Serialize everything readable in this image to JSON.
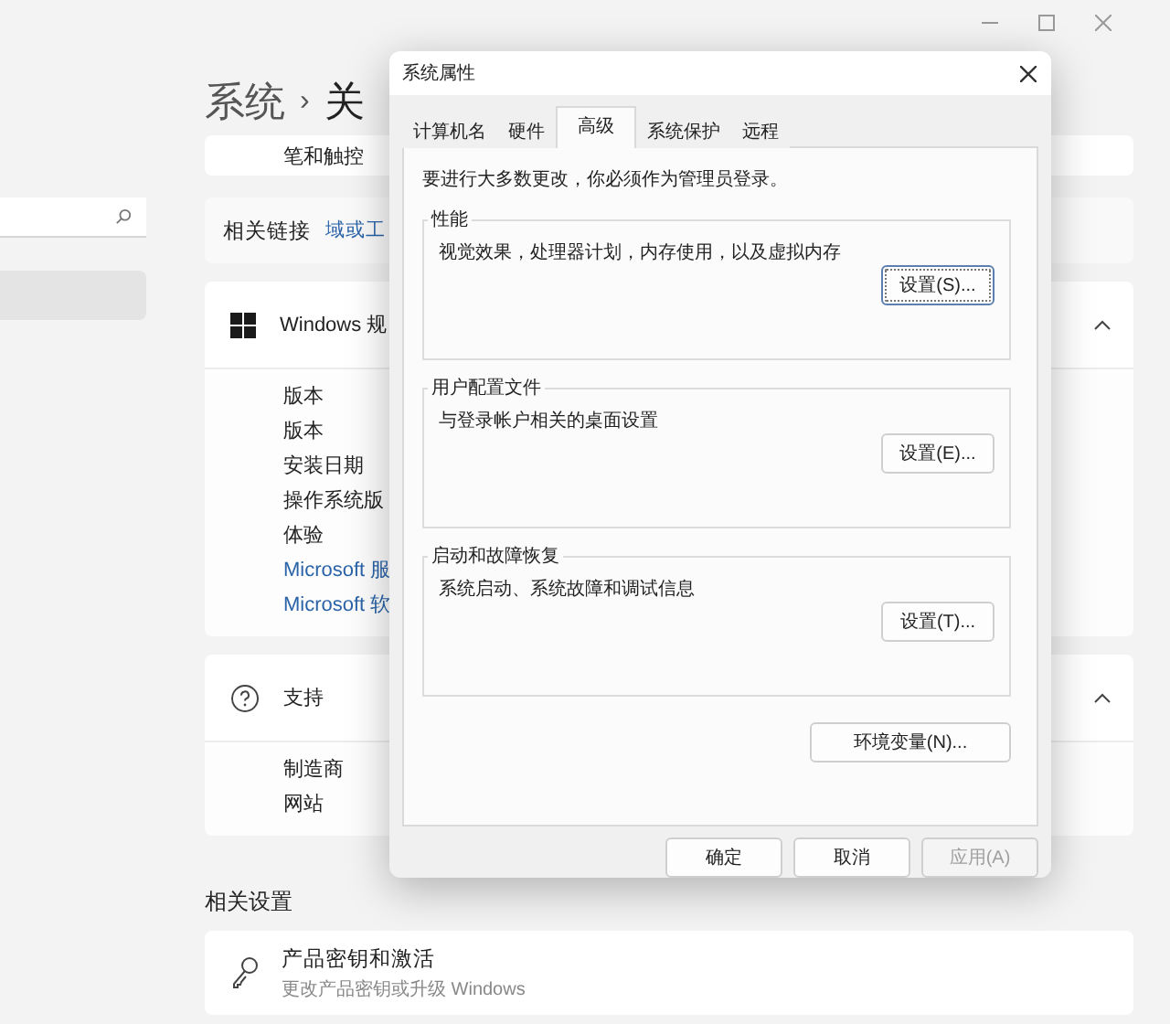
{
  "sidebar": {
    "items": [
      {
        "selected": true
      }
    ]
  },
  "breadcrumb": {
    "parent": "系统",
    "separator": "›",
    "current": "关"
  },
  "top_card": {
    "label": "笔和触控"
  },
  "related_links": {
    "label": "相关链接",
    "link": "域或工"
  },
  "sections": [
    {
      "kind": "windows",
      "title": "Windows 规",
      "expanded": true,
      "rows": [
        {
          "text": "版本",
          "kind": "text"
        },
        {
          "text": "版本",
          "kind": "text"
        },
        {
          "text": "安装日期",
          "kind": "text"
        },
        {
          "text": "操作系统版",
          "kind": "text"
        },
        {
          "text": "体验",
          "kind": "text"
        },
        {
          "text": "Microsoft 服",
          "kind": "link"
        },
        {
          "text": "Microsoft 软",
          "kind": "link"
        }
      ]
    },
    {
      "kind": "help",
      "title": "支持",
      "expanded": true,
      "rows": [
        {
          "text": "制造商",
          "kind": "text"
        },
        {
          "text": "网站",
          "kind": "text"
        }
      ]
    }
  ],
  "related_settings": {
    "heading": "相关设置",
    "items": [
      {
        "title": "产品密钥和激活",
        "subtitle": "更改产品密钥或升级 Windows"
      }
    ]
  },
  "dialog": {
    "title": "系统属性",
    "tabs": [
      {
        "label": "计算机名",
        "selected": false
      },
      {
        "label": "硬件",
        "selected": false
      },
      {
        "label": "高级",
        "selected": true
      },
      {
        "label": "系统保护",
        "selected": false
      },
      {
        "label": "远程",
        "selected": false
      }
    ],
    "notice": "要进行大多数更改，你必须作为管理员登录。",
    "groups": [
      {
        "title": "性能",
        "description": "视觉效果，处理器计划，内存使用，以及虚拟内存",
        "button": "设置(S)...",
        "focused": true
      },
      {
        "title": "用户配置文件",
        "description": "与登录帐户相关的桌面设置",
        "button": "设置(E)...",
        "focused": false
      },
      {
        "title": "启动和故障恢复",
        "description": "系统启动、系统故障和调试信息",
        "button": "设置(T)...",
        "focused": false
      }
    ],
    "env_button": "环境变量(N)...",
    "footer": [
      {
        "label": "确定",
        "disabled": false
      },
      {
        "label": "取消",
        "disabled": false
      },
      {
        "label": "应用(A)",
        "disabled": true
      }
    ]
  }
}
